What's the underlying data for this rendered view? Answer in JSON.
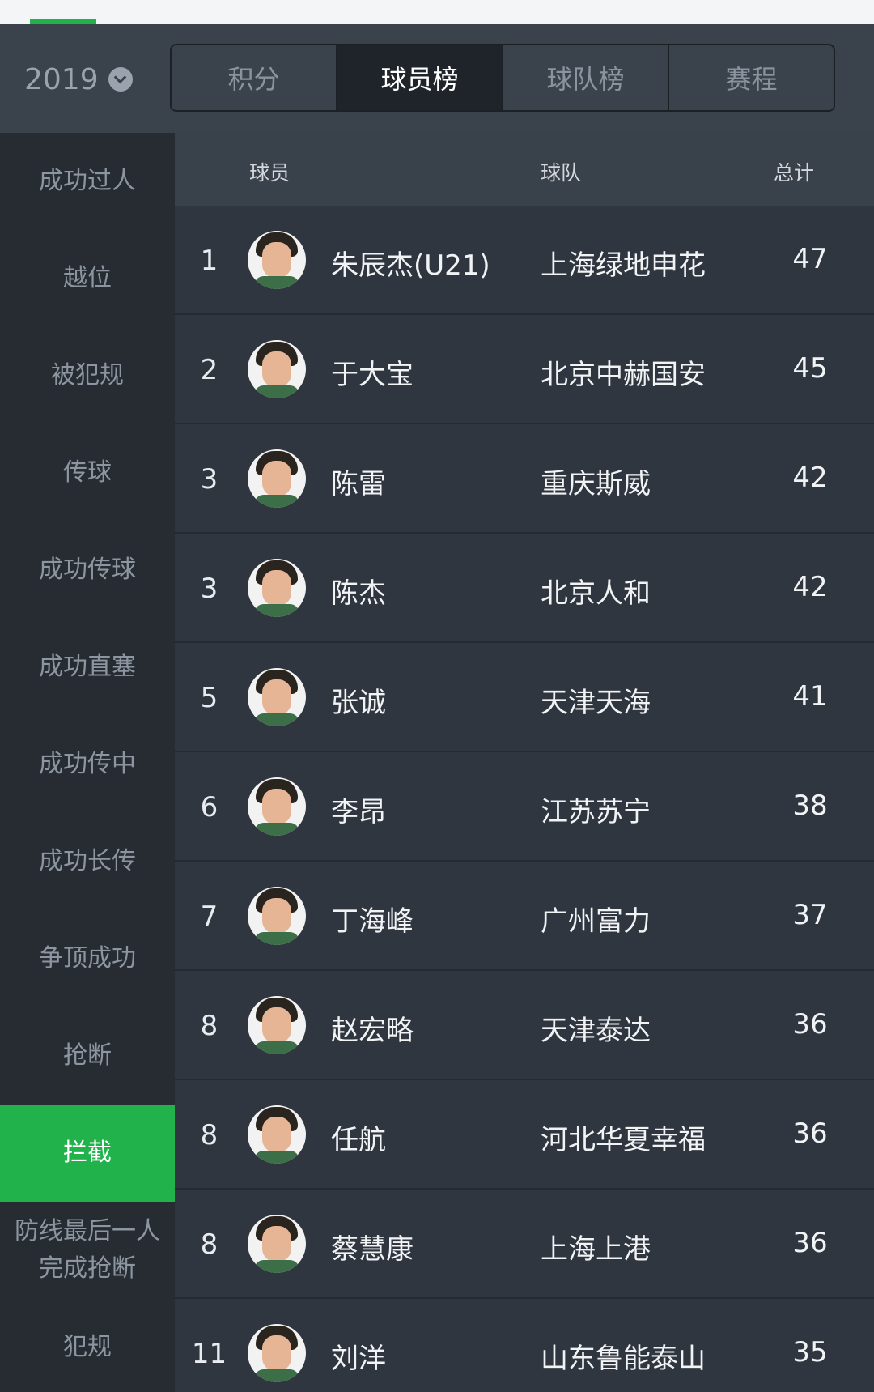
{
  "header": {
    "year": "2019",
    "tabs": [
      {
        "label": "积分"
      },
      {
        "label": "球员榜"
      },
      {
        "label": "球队榜"
      },
      {
        "label": "赛程"
      }
    ]
  },
  "sidebar": {
    "items": [
      {
        "label": "成功过人"
      },
      {
        "label": "越位"
      },
      {
        "label": "被犯规"
      },
      {
        "label": "传球"
      },
      {
        "label": "成功传球"
      },
      {
        "label": "成功直塞"
      },
      {
        "label": "成功传中"
      },
      {
        "label": "成功长传"
      },
      {
        "label": "争顶成功"
      },
      {
        "label": "抢断"
      },
      {
        "label": "拦截"
      },
      {
        "label": "防线最后一人完成抢断"
      },
      {
        "label": "犯规"
      }
    ],
    "active_index": 10
  },
  "table": {
    "columns": {
      "player": "球员",
      "team": "球队",
      "total": "总计"
    },
    "rows": [
      {
        "rank": "1",
        "name": "朱辰杰(U21)",
        "team": "上海绿地申花",
        "total": "47"
      },
      {
        "rank": "2",
        "name": "于大宝",
        "team": "北京中赫国安",
        "total": "45"
      },
      {
        "rank": "3",
        "name": "陈雷",
        "team": "重庆斯威",
        "total": "42"
      },
      {
        "rank": "3",
        "name": "陈杰",
        "team": "北京人和",
        "total": "42"
      },
      {
        "rank": "5",
        "name": "张诚",
        "team": "天津天海",
        "total": "41"
      },
      {
        "rank": "6",
        "name": "李昂",
        "team": "江苏苏宁",
        "total": "38"
      },
      {
        "rank": "7",
        "name": "丁海峰",
        "team": "广州富力",
        "total": "37"
      },
      {
        "rank": "8",
        "name": "赵宏略",
        "team": "天津泰达",
        "total": "36"
      },
      {
        "rank": "8",
        "name": "任航",
        "team": "河北华夏幸福",
        "total": "36"
      },
      {
        "rank": "8",
        "name": "蔡慧康",
        "team": "上海上港",
        "total": "36"
      },
      {
        "rank": "11",
        "name": "刘洋",
        "team": "山东鲁能泰山",
        "total": "35"
      }
    ]
  },
  "colors": {
    "accent": "#22b24c",
    "background": "#2b3138",
    "sidebar": "#272c33",
    "header": "#3a424c"
  }
}
